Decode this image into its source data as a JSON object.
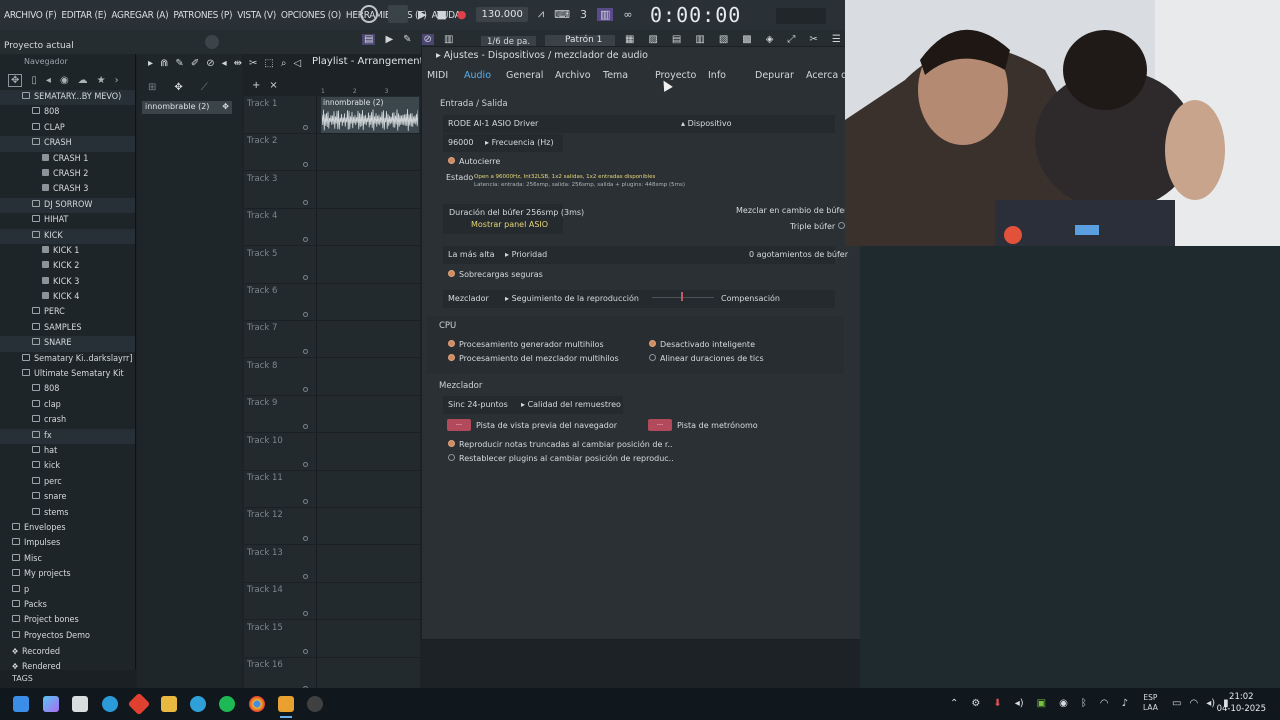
{
  "menubar": {
    "items": [
      "ARCHIVO (F)",
      "EDITAR (E)",
      "AGREGAR (A)",
      "PATRONES (P)",
      "VISTA (V)",
      "OPCIONES (O)",
      "HERRAMIENTAS (T)",
      "AYUDA"
    ],
    "tempo": "130.000",
    "time": "0:00:00"
  },
  "toolbar2": {
    "project_label": "Proyecto actual",
    "step": "1/6 de pa.",
    "pattern": "Patrón 1"
  },
  "browser": {
    "header": "Navegador",
    "items": [
      {
        "label": "SEMATARY...BY MEVO)",
        "type": "folder",
        "indent": 2
      },
      {
        "label": "808",
        "type": "folder",
        "indent": 3
      },
      {
        "label": "CLAP",
        "type": "folder",
        "indent": 3
      },
      {
        "label": "CRASH",
        "type": "folder",
        "indent": 3
      },
      {
        "label": "CRASH 1",
        "type": "file",
        "indent": 4
      },
      {
        "label": "CRASH 2",
        "type": "file",
        "indent": 4
      },
      {
        "label": "CRASH 3",
        "type": "file",
        "indent": 4
      },
      {
        "label": "DJ SORROW",
        "type": "folder",
        "indent": 3
      },
      {
        "label": "HIHAT",
        "type": "folder",
        "indent": 3
      },
      {
        "label": "KICK",
        "type": "folder",
        "indent": 3
      },
      {
        "label": "KICK 1",
        "type": "file",
        "indent": 4
      },
      {
        "label": "KICK 2",
        "type": "file",
        "indent": 4
      },
      {
        "label": "KICK 3",
        "type": "file",
        "indent": 4
      },
      {
        "label": "KICK 4",
        "type": "file",
        "indent": 4
      },
      {
        "label": "PERC",
        "type": "folder",
        "indent": 3
      },
      {
        "label": "SAMPLES",
        "type": "folder",
        "indent": 3
      },
      {
        "label": "SNARE",
        "type": "folder",
        "indent": 3
      },
      {
        "label": "Sematary Ki..darkslayrr]",
        "type": "folder",
        "indent": 2
      },
      {
        "label": "Ultimate Sematary Kit",
        "type": "folder",
        "indent": 2
      },
      {
        "label": "808",
        "type": "folder",
        "indent": 3
      },
      {
        "label": "clap",
        "type": "folder",
        "indent": 3
      },
      {
        "label": "crash",
        "type": "folder",
        "indent": 3
      },
      {
        "label": "fx",
        "type": "folder",
        "indent": 3
      },
      {
        "label": "hat",
        "type": "folder",
        "indent": 3
      },
      {
        "label": "kick",
        "type": "folder",
        "indent": 3
      },
      {
        "label": "perc",
        "type": "folder",
        "indent": 3
      },
      {
        "label": "snare",
        "type": "folder",
        "indent": 3
      },
      {
        "label": "stems",
        "type": "folder",
        "indent": 3
      },
      {
        "label": "Envelopes",
        "type": "folder",
        "indent": 1
      },
      {
        "label": "Impulses",
        "type": "folder",
        "indent": 1
      },
      {
        "label": "Misc",
        "type": "folder",
        "indent": 1
      },
      {
        "label": "My projects",
        "type": "folder",
        "indent": 1
      },
      {
        "label": "p",
        "type": "folder",
        "indent": 1
      },
      {
        "label": "Packs",
        "type": "folder",
        "indent": 1
      },
      {
        "label": "Project bones",
        "type": "folder",
        "indent": 1
      },
      {
        "label": "Proyectos Demo",
        "type": "folder",
        "indent": 1
      },
      {
        "label": "Recorded",
        "type": "plus",
        "indent": 1
      },
      {
        "label": "Rendered",
        "type": "plus",
        "indent": 1
      }
    ],
    "tags": "TAGS"
  },
  "picker": {
    "pattern": "innombrable (2)"
  },
  "playlist": {
    "title": "Playlist - Arrangement",
    "clip": "innombrable (2)",
    "tracks": [
      "Track 1",
      "Track 2",
      "Track 3",
      "Track 4",
      "Track 5",
      "Track 6",
      "Track 7",
      "Track 8",
      "Track 9",
      "Track 10",
      "Track 11",
      "Track 12",
      "Track 13",
      "Track 14",
      "Track 15",
      "Track 16"
    ],
    "ruler": [
      "1",
      "2",
      "3"
    ]
  },
  "dialog": {
    "title": "Ajustes - Dispositivos / mezclador de audio",
    "tabs": [
      "MIDI",
      "Audio",
      "General",
      "Archivo",
      "Tema",
      "Proyecto",
      "Info",
      "Depurar",
      "Acerca de"
    ],
    "active_tab": "Audio",
    "io_section": "Entrada / Salida",
    "driver": "RODE AI-1 ASIO Driver",
    "device_label": "Dispositivo",
    "rate": "96000",
    "rate_label": "Frecuencia (Hz)",
    "autoclose": "Autocierre",
    "status_label": "Estado",
    "status_line1": "Open a 96000Hz, Int32LSB, 1x2 salidas, 1x2 entradas disponibles",
    "status_line2": "Latencia: entrada: 256smp, salida: 256smp, salida + plugins: 448smp (5ms)",
    "buffer": "Duración del búfer 256smp (3ms)",
    "asio_panel": "Mostrar panel ASIO",
    "mix_buffer": "Mezclar en cambio de búfer",
    "triple_buffer": "Triple búfer",
    "priority_value": "La más alta",
    "priority_label": "Prioridad",
    "underruns": "0 agotamientos de búfer",
    "safe_overloads": "Sobrecargas seguras",
    "mixer_value": "Mezclador",
    "tracking_label": "Seguimiento de la reproducción",
    "compensation": "Compensación",
    "cpu_section": "CPU",
    "cpu_opts": [
      "Procesamiento generador multihilos",
      "Procesamiento del mezclador multihilos"
    ],
    "cpu_opts_right": [
      "Desactivado inteligente",
      "Alinear duraciones de tics"
    ],
    "mixer_section": "Mezclador",
    "resample_value": "Sinc 24-puntos",
    "resample_label": "Calidad del remuestreo",
    "preview_track": "Pista de vista previa del navegador",
    "metronome_track": "Pista de metrónomo",
    "swatch_text": "---",
    "opt_truncated": "Reproducir notas truncadas al cambiar posición de r..",
    "opt_reset": "Restablecer plugins al cambiar posición de reproduc.."
  },
  "taskbar": {
    "lang1": "ESP",
    "lang2": "LAA",
    "time": "21:02",
    "date": "04-10-2025"
  }
}
